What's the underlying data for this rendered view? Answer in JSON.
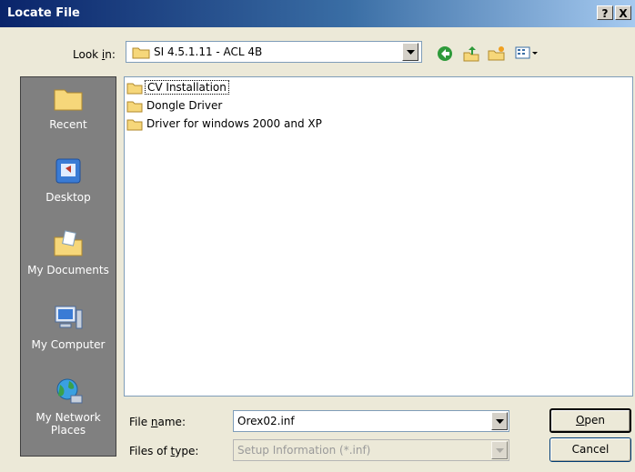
{
  "window": {
    "title": "Locate File",
    "help_label": "?",
    "close_label": "X"
  },
  "look_in": {
    "label_pre": "Look ",
    "label_u": "i",
    "label_post": "n:",
    "value": "SI 4.5.1.11 - ACL 4B"
  },
  "toolbar": {
    "icons": [
      "back-icon",
      "up-folder-icon",
      "new-folder-icon",
      "view-menu-icon"
    ]
  },
  "places": [
    {
      "label": "Recent",
      "icon": "recent-folder-icon"
    },
    {
      "label": "Desktop",
      "icon": "desktop-icon"
    },
    {
      "label": "My Documents",
      "icon": "my-documents-icon"
    },
    {
      "label": "My Computer",
      "icon": "my-computer-icon"
    },
    {
      "label": "My Network Places",
      "icon": "network-places-icon"
    }
  ],
  "files": [
    {
      "name": "CV Installation"
    },
    {
      "name": "Dongle Driver"
    },
    {
      "name": "Driver for windows 2000 and XP"
    }
  ],
  "file_name": {
    "label_pre": "File ",
    "label_u": "n",
    "label_post": "ame:",
    "value": "Orex02.inf"
  },
  "file_type": {
    "label_pre": "Files of ",
    "label_u": "t",
    "label_post": "ype:",
    "value": "Setup Information (*.inf)"
  },
  "buttons": {
    "open_u": "O",
    "open_rest": "pen",
    "cancel": "Cancel"
  },
  "colors": {
    "title_start": "#0a246a",
    "title_end": "#a6caf0",
    "places_bg": "#808080",
    "dialog_bg": "#ece9d8"
  }
}
